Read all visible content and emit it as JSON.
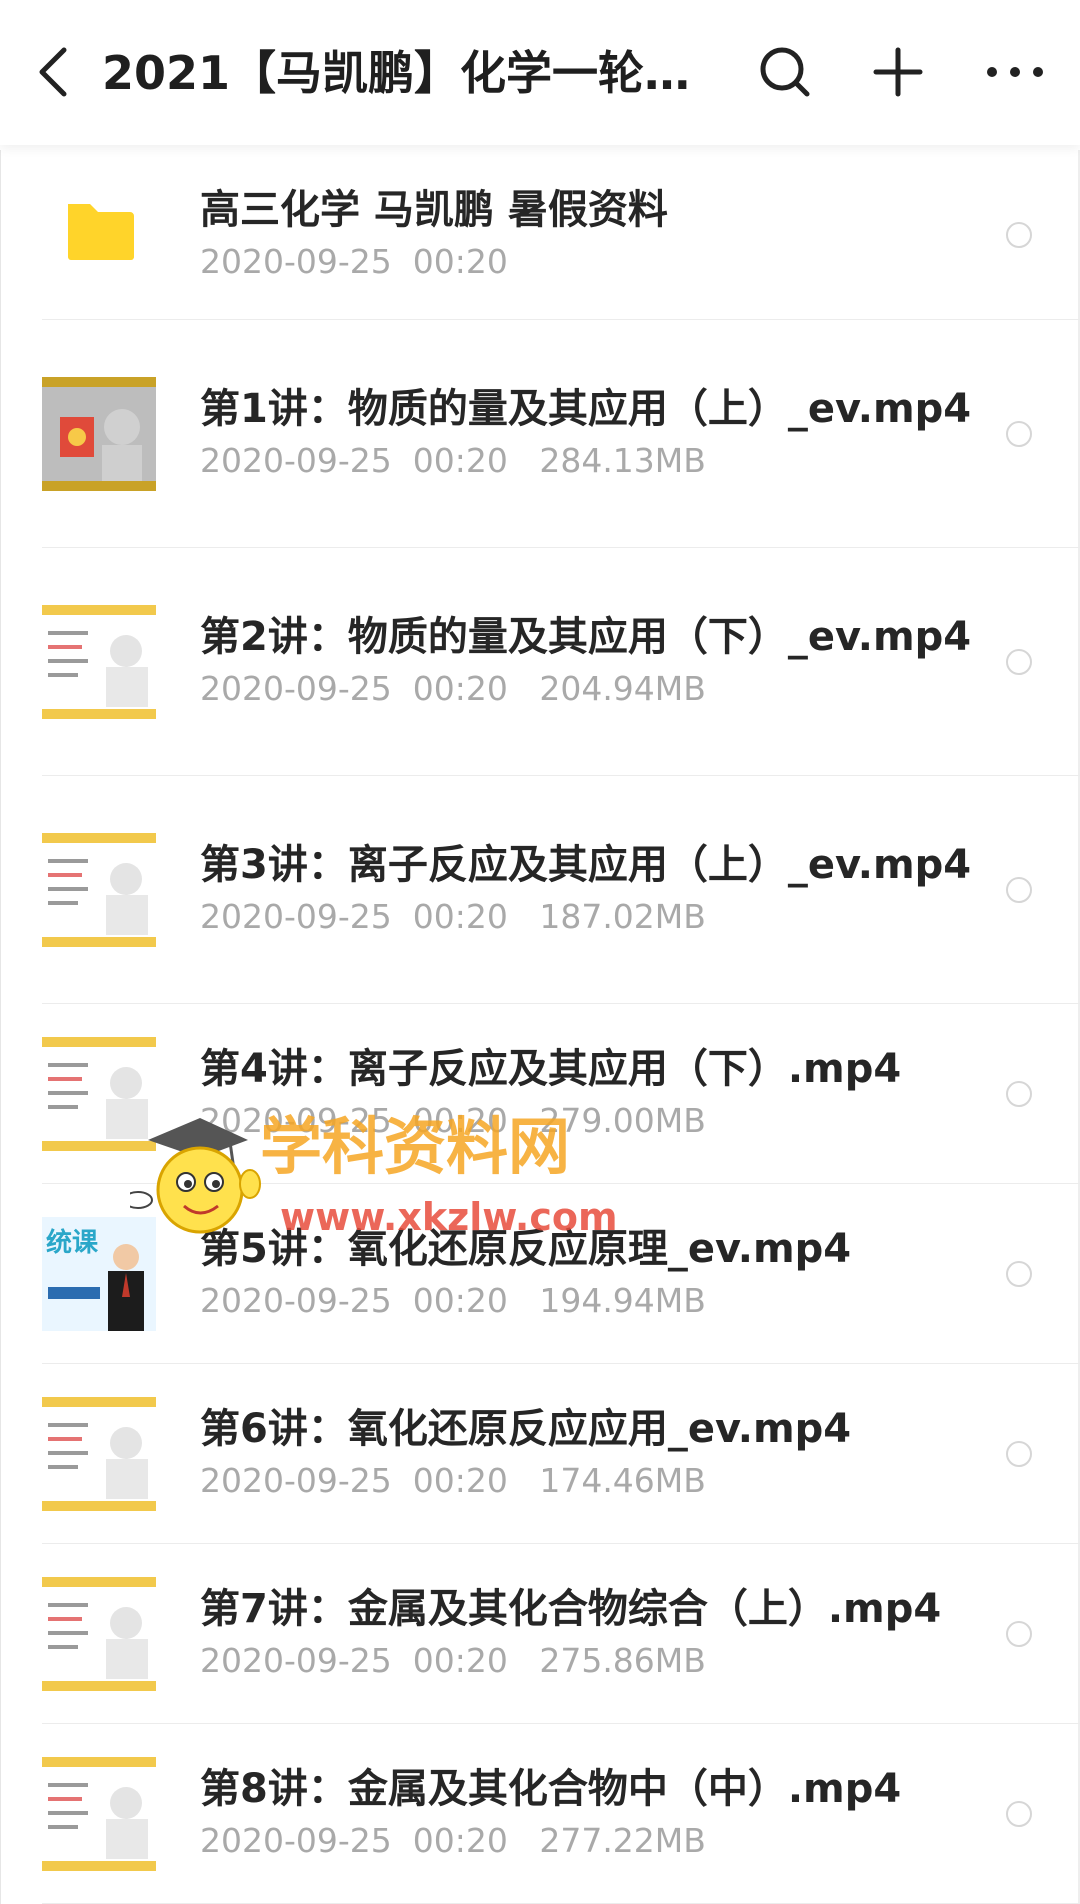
{
  "header": {
    "title": "2021【马凯鹏】化学一轮暑…",
    "back_icon": "chevron-left-icon",
    "search_icon": "search-icon",
    "add_icon": "plus-icon",
    "more_icon": "more-dots-icon"
  },
  "files": [
    {
      "type": "folder",
      "name": "高三化学 马凯鹏 暑假资料",
      "meta": "2020-09-25  00:20"
    },
    {
      "type": "video",
      "name": "第1讲：物质的量及其应用（上）_ev.mp4",
      "meta": "2020-09-25  00:20   284.13MB"
    },
    {
      "type": "video",
      "name": "第2讲：物质的量及其应用（下）_ev.mp4",
      "meta": "2020-09-25  00:20   204.94MB"
    },
    {
      "type": "video",
      "name": "第3讲：离子反应及其应用（上）_ev.mp4",
      "meta": "2020-09-25  00:20   187.02MB"
    },
    {
      "type": "video",
      "name": "第4讲：离子反应及其应用（下）.mp4",
      "meta": "2020-09-25  00:20   279.00MB"
    },
    {
      "type": "video",
      "name": "第5讲：氧化还原反应原理_ev.mp4",
      "meta": "2020-09-25  00:20   194.94MB"
    },
    {
      "type": "video",
      "name": "第6讲：氧化还原反应应用_ev.mp4",
      "meta": "2020-09-25  00:20   174.46MB"
    },
    {
      "type": "video",
      "name": "第7讲：金属及其化合物综合（上）.mp4",
      "meta": "2020-09-25  00:20   275.86MB"
    },
    {
      "type": "video",
      "name": "第8讲：金属及其化合物中（中）.mp4",
      "meta": "2020-09-25  00:20   277.22MB"
    }
  ],
  "watermark": {
    "brand": "学科资料网",
    "url": "www.xkzlw.com"
  },
  "colors": {
    "folder": "#ffd42a",
    "thumb_yellow": "#f2c94c",
    "meta_text": "#a9a9a9"
  }
}
